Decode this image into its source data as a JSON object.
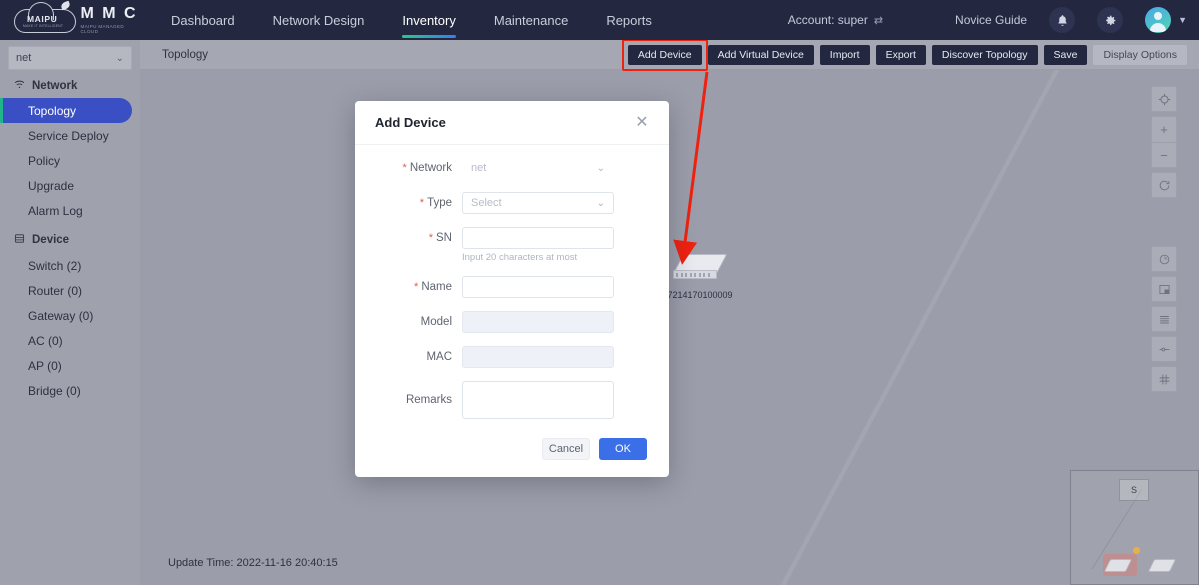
{
  "brand": {
    "name": "M M C",
    "tagline": "MAIPU MANAGED CLOUD",
    "logo_word": "MAIPU",
    "logo_sub": "MAKE IT INTELLIGENT"
  },
  "topnav": {
    "items": [
      {
        "label": "Dashboard",
        "active": false
      },
      {
        "label": "Network Design",
        "active": false
      },
      {
        "label": "Inventory",
        "active": true
      },
      {
        "label": "Maintenance",
        "active": false
      },
      {
        "label": "Reports",
        "active": false
      }
    ],
    "account_label": "Account: super",
    "swap_icon": "swap-icon",
    "novice_guide": "Novice Guide",
    "bell_icon": "bell-icon",
    "gear_icon": "gear-icon",
    "avatar_icon": "avatar-icon",
    "caret_icon": "chevron-down-icon"
  },
  "sidebar": {
    "network_select_value": "net",
    "network_select_chevron": "chevron-down-icon",
    "groups": [
      {
        "title": "Network",
        "icon": "wifi-icon",
        "items": [
          {
            "label": "Topology",
            "active": true
          },
          {
            "label": "Service Deploy",
            "active": false
          },
          {
            "label": "Policy",
            "active": false
          },
          {
            "label": "Upgrade",
            "active": false
          },
          {
            "label": "Alarm Log",
            "active": false
          }
        ]
      },
      {
        "title": "Device",
        "icon": "server-icon",
        "items": [
          {
            "label": "Switch (2)",
            "active": false
          },
          {
            "label": "Router (0)",
            "active": false
          },
          {
            "label": "Gateway (0)",
            "active": false
          },
          {
            "label": "AC (0)",
            "active": false
          },
          {
            "label": "AP (0)",
            "active": false
          },
          {
            "label": "Bridge (0)",
            "active": false
          }
        ]
      }
    ]
  },
  "toolbar": {
    "breadcrumb": "Topology",
    "buttons": [
      {
        "label": "Add Device",
        "style": "dark",
        "highlighted": true
      },
      {
        "label": "Add Virtual Device",
        "style": "dark",
        "highlighted": false
      },
      {
        "label": "Import",
        "style": "dark",
        "highlighted": false
      },
      {
        "label": "Export",
        "style": "dark",
        "highlighted": false
      },
      {
        "label": "Discover Topology",
        "style": "dark",
        "highlighted": false
      },
      {
        "label": "Save",
        "style": "dark",
        "highlighted": false
      },
      {
        "label": "Display Options",
        "style": "muted",
        "highlighted": false
      }
    ]
  },
  "canvas": {
    "device_node_label": "7214170100009",
    "update_time": "Update Time: 2022-11-16 20:40:15",
    "right_tools_group1": [
      {
        "icon": "locate-target-icon"
      },
      {
        "icon": "zoom-in-icon"
      },
      {
        "icon": "zoom-out-icon"
      },
      {
        "icon": "refresh-icon"
      }
    ],
    "right_tools_group2": [
      {
        "icon": "clock-pie-icon"
      },
      {
        "icon": "layout-panel-icon"
      },
      {
        "icon": "list-lines-icon"
      },
      {
        "icon": "slider-icon"
      },
      {
        "icon": "grid-icon"
      }
    ],
    "minimap_label": "S"
  },
  "annotation": {
    "arrow_color": "#ee2211",
    "highlight_color": "#ee2211"
  },
  "modal": {
    "title": "Add Device",
    "close_icon": "close-icon",
    "fields": [
      {
        "label": "Network",
        "required": true,
        "type": "select-plain",
        "value": "net",
        "placeholder": "net",
        "disabled": true,
        "hint": ""
      },
      {
        "label": "Type",
        "required": true,
        "type": "select",
        "value": "",
        "placeholder": "Select",
        "disabled": false,
        "hint": ""
      },
      {
        "label": "SN",
        "required": true,
        "type": "input",
        "value": "",
        "placeholder": "",
        "disabled": false,
        "hint": "Input 20 characters at most"
      },
      {
        "label": "Name",
        "required": true,
        "type": "input",
        "value": "",
        "placeholder": "",
        "disabled": false,
        "hint": ""
      },
      {
        "label": "Model",
        "required": false,
        "type": "input",
        "value": "",
        "placeholder": "",
        "disabled": true,
        "hint": ""
      },
      {
        "label": "MAC",
        "required": false,
        "type": "input",
        "value": "",
        "placeholder": "",
        "disabled": true,
        "hint": ""
      },
      {
        "label": "Remarks",
        "required": false,
        "type": "textarea",
        "value": "",
        "placeholder": "",
        "disabled": false,
        "hint": ""
      }
    ],
    "cancel_label": "Cancel",
    "ok_label": "OK"
  },
  "colors": {
    "nav_bg": "#232840",
    "accent_blue": "#3b6fe8",
    "accent_green": "#21b38a",
    "canvas_bg": "#9b9eaa",
    "sidebar_bg": "#9fa2ad",
    "annotation_red": "#ee2211"
  }
}
